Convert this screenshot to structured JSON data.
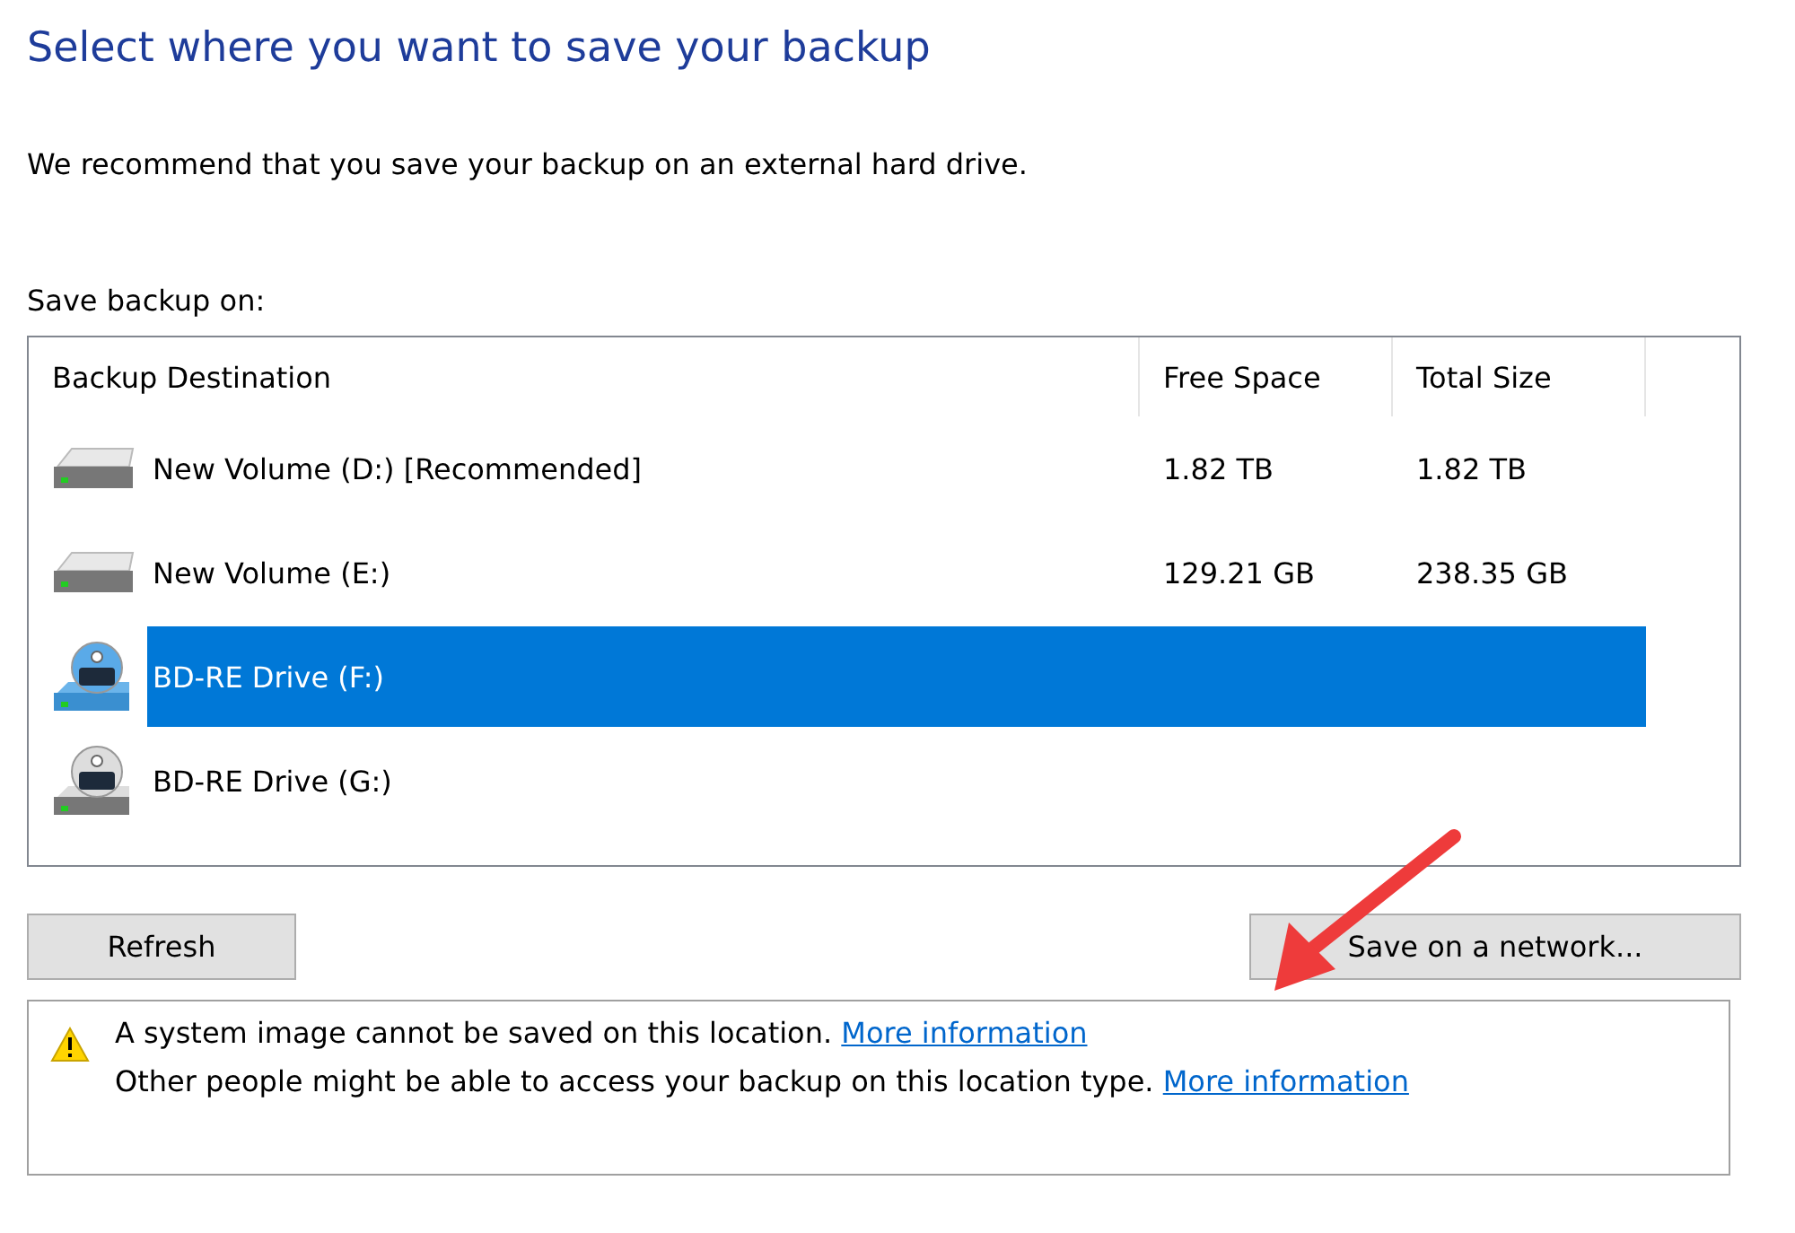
{
  "title": "Select where you want to save your backup",
  "intro": "We recommend that you save your backup on an external hard drive.",
  "list_label": "Save backup on:",
  "table": {
    "columns": [
      "Backup Destination",
      "Free Space",
      "Total Size"
    ],
    "rows": [
      {
        "kind": "hdd",
        "name": "New Volume (D:) [Recommended]",
        "free": "1.82 TB",
        "total": "1.82 TB",
        "selected": false
      },
      {
        "kind": "hdd",
        "name": "New Volume (E:)",
        "free": "129.21 GB",
        "total": "238.35 GB",
        "selected": false
      },
      {
        "kind": "bd",
        "name": "BD-RE Drive (F:)",
        "selected": true
      },
      {
        "kind": "bd",
        "name": "BD-RE Drive (G:)",
        "selected": false
      }
    ]
  },
  "buttons": {
    "refresh": "Refresh",
    "network": "Save on a network..."
  },
  "messages": [
    {
      "text": "A system image cannot be saved on this location.",
      "link": "More information"
    },
    {
      "text": "Other people might be able to access your backup on this location type.",
      "link": "More information"
    }
  ]
}
